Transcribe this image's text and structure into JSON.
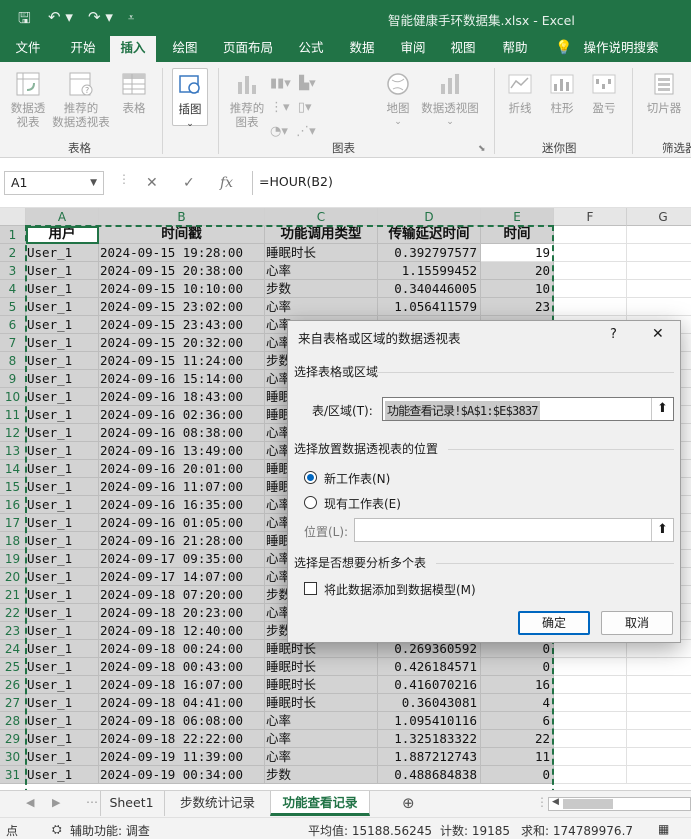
{
  "window": {
    "title": "智能健康手环数据集.xlsx  -  Excel"
  },
  "quick_access": {
    "save_icon": "save-icon",
    "undo_icon": "undo-icon",
    "redo_icon": "redo-icon",
    "more_icon": "customize-icon"
  },
  "ribbon_tabs": [
    "文件",
    "开始",
    "插入",
    "绘图",
    "页面布局",
    "公式",
    "数据",
    "审阅",
    "视图",
    "帮助",
    "操作说明搜索"
  ],
  "ribbon": {
    "btn_pivot1": "数据透\n视表",
    "btn_pivot2": "推荐的\n数据透视表",
    "btn_table": "表格",
    "grp_table": "表格",
    "btn_illus": "插图",
    "btn_recchart": "推荐的\n图表",
    "btn_map": "地图",
    "btn_pivotchart": "数据透视图",
    "grp_chart": "图表",
    "btn_line": "折线",
    "btn_col": "柱形",
    "btn_wl": "盈亏",
    "grp_spark": "迷你图",
    "btn_slicer": "切片器",
    "grp_filter": "筛选器"
  },
  "formula_bar": {
    "name_box": "A1",
    "formula": "=HOUR(B2)",
    "fx": "fx"
  },
  "columns": [
    "A",
    "B",
    "C",
    "D",
    "E",
    "F",
    "G"
  ],
  "header_row": [
    "用户",
    "时间戳",
    "功能调用类型",
    "传输延迟时间",
    "时间"
  ],
  "rows": [
    [
      "User_1",
      "2024-09-15 19:28:00",
      "睡眠时长",
      "0.392797577",
      "19"
    ],
    [
      "User_1",
      "2024-09-15 20:38:00",
      "心率",
      "1.15599452",
      "20"
    ],
    [
      "User_1",
      "2024-09-15 10:10:00",
      "步数",
      "0.340446005",
      "10"
    ],
    [
      "User_1",
      "2024-09-15 23:02:00",
      "心率",
      "1.056411579",
      "23"
    ],
    [
      "User_1",
      "2024-09-15 23:43:00",
      "心率",
      "",
      ""
    ],
    [
      "User_1",
      "2024-09-15 20:32:00",
      "心率",
      "",
      ""
    ],
    [
      "User_1",
      "2024-09-15 11:24:00",
      "步数",
      "",
      ""
    ],
    [
      "User_1",
      "2024-09-16 15:14:00",
      "心率",
      "",
      ""
    ],
    [
      "User_1",
      "2024-09-16 18:43:00",
      "睡眠",
      "",
      ""
    ],
    [
      "User_1",
      "2024-09-16 02:36:00",
      "睡眠",
      "",
      ""
    ],
    [
      "User_1",
      "2024-09-16 08:38:00",
      "心率",
      "",
      ""
    ],
    [
      "User_1",
      "2024-09-16 13:49:00",
      "心率",
      "",
      ""
    ],
    [
      "User_1",
      "2024-09-16 20:01:00",
      "睡眠",
      "",
      ""
    ],
    [
      "User_1",
      "2024-09-16 11:07:00",
      "睡眠",
      "",
      ""
    ],
    [
      "User_1",
      "2024-09-16 16:35:00",
      "心率",
      "",
      ""
    ],
    [
      "User_1",
      "2024-09-16 01:05:00",
      "心率",
      "",
      ""
    ],
    [
      "User_1",
      "2024-09-16 21:28:00",
      "睡眠",
      "",
      ""
    ],
    [
      "User_1",
      "2024-09-17 09:35:00",
      "心率",
      "",
      ""
    ],
    [
      "User_1",
      "2024-09-17 14:07:00",
      "心率",
      "",
      ""
    ],
    [
      "User_1",
      "2024-09-18 07:20:00",
      "步数",
      "",
      ""
    ],
    [
      "User_1",
      "2024-09-18 20:23:00",
      "心率",
      "",
      ""
    ],
    [
      "User_1",
      "2024-09-18 12:40:00",
      "步数",
      "",
      ""
    ],
    [
      "User_1",
      "2024-09-18 00:24:00",
      "睡眠时长",
      "0.269360592",
      "0"
    ],
    [
      "User_1",
      "2024-09-18 00:43:00",
      "睡眠时长",
      "0.426184571",
      "0"
    ],
    [
      "User_1",
      "2024-09-18 16:07:00",
      "睡眠时长",
      "0.416070216",
      "16"
    ],
    [
      "User_1",
      "2024-09-18 04:41:00",
      "睡眠时长",
      "0.36043081",
      "4"
    ],
    [
      "User_1",
      "2024-09-18 06:08:00",
      "心率",
      "1.095410116",
      "6"
    ],
    [
      "User_1",
      "2024-09-18 22:22:00",
      "心率",
      "1.325183322",
      "22"
    ],
    [
      "User_1",
      "2024-09-19 11:39:00",
      "心率",
      "1.887212743",
      "11"
    ],
    [
      "User_1",
      "2024-09-19 00:34:00",
      "步数",
      "0.488684838",
      "0"
    ]
  ],
  "sheet_tabs": [
    "Sheet1",
    "步数统计记录",
    "功能查看记录"
  ],
  "status": {
    "ready": "点",
    "accessibility": "辅助功能: 调查",
    "average": "平均值: 15188.56245",
    "count": "计数: 19185",
    "sum": "求和: 174789976.7"
  },
  "dialog": {
    "title": "来自表格或区域的数据透视表",
    "help": "?",
    "close": "✕",
    "section1": "选择表格或区域",
    "range_label": "表/区域(T):",
    "range_value": "功能查看记录!$A$1:$E$3837",
    "section2": "选择放置数据透视表的位置",
    "opt_new": "新工作表(N)",
    "opt_existing": "现有工作表(E)",
    "location_label": "位置(L):",
    "location_value": "",
    "section3": "选择是否想要分析多个表",
    "checkbox_label": "将此数据添加到数据模型(M)",
    "ok": "确定",
    "cancel": "取消"
  },
  "colors": {
    "excel_green": "#217346",
    "selection_gray": "#d3d3d3",
    "dialog_bg": "#f0f0f0",
    "primary_blue": "#0067c0"
  }
}
